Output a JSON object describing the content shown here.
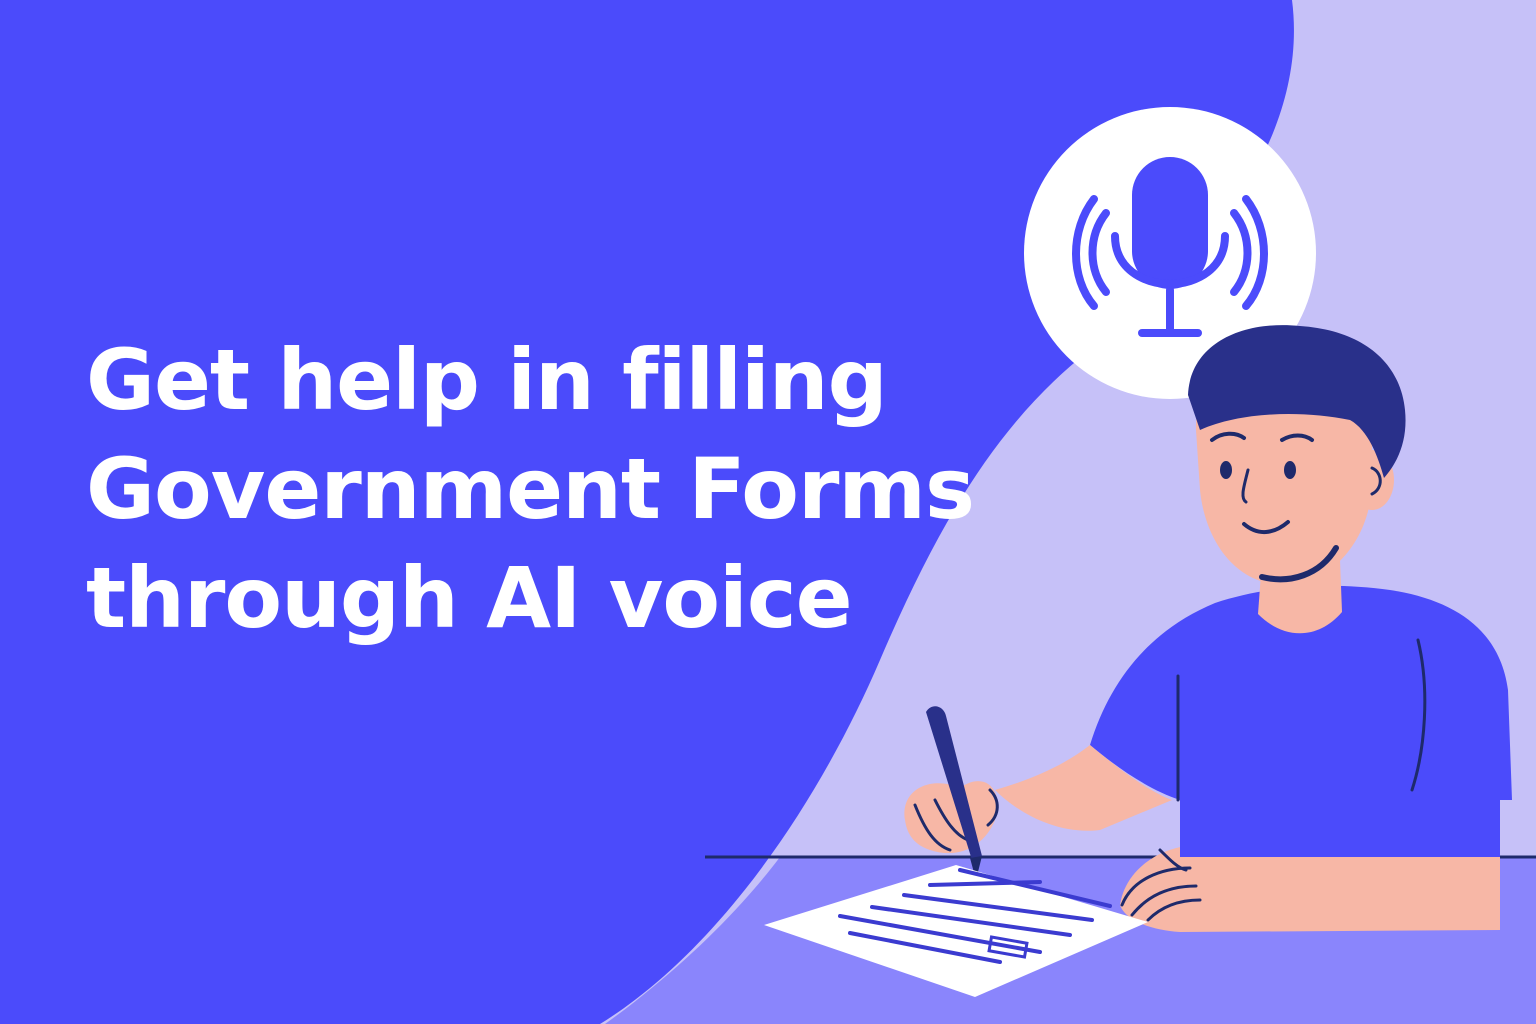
{
  "headline": {
    "lines": [
      "Get help in filling",
      "Government Forms",
      "through AI voice"
    ]
  },
  "icons": {
    "mic": "microphone-icon",
    "person": "person-writing-illustration",
    "document": "paper-form",
    "pen": "pen-icon"
  },
  "colors": {
    "background": "#4b4bfb",
    "lavender_panel": "#c6c1f8",
    "desk": "#8a85fc",
    "skin": "#f7b7a6",
    "hair": "#29308a",
    "shirt": "#4b4bfb",
    "white": "#ffffff"
  }
}
